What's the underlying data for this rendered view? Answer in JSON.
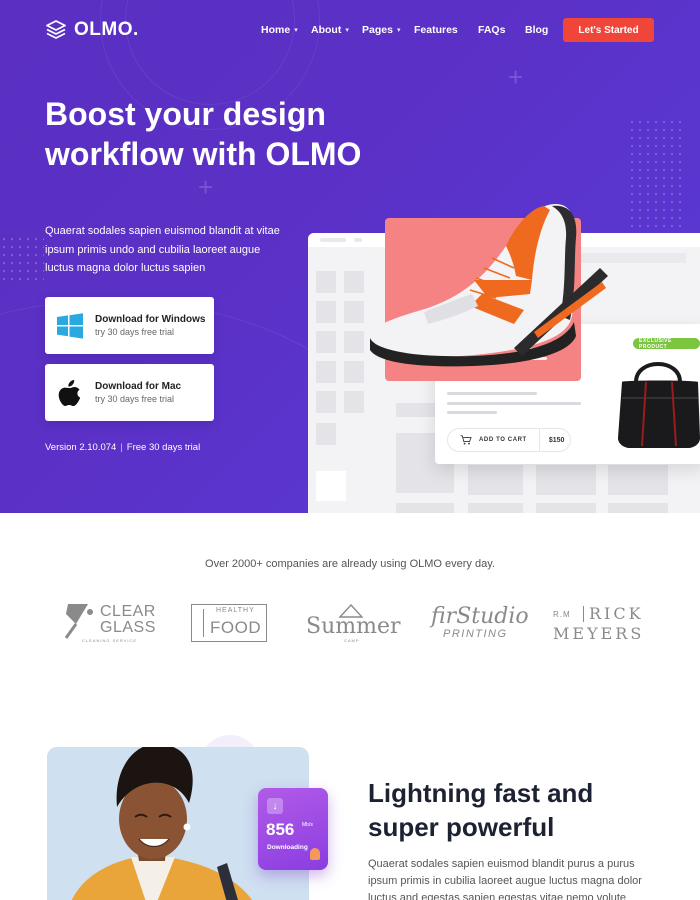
{
  "brand": {
    "name": "OLMO."
  },
  "nav": {
    "items": [
      {
        "label": "Home",
        "has_dropdown": true
      },
      {
        "label": "About",
        "has_dropdown": true
      },
      {
        "label": "Pages",
        "has_dropdown": true
      },
      {
        "label": "Features",
        "has_dropdown": false
      },
      {
        "label": "FAQs",
        "has_dropdown": false
      },
      {
        "label": "Blog",
        "has_dropdown": false
      }
    ],
    "cta_label": "Let's Started"
  },
  "hero": {
    "title": "Boost your design workflow with OLMO",
    "description": "Quaerat sodales sapien euismod blandit at vitae ipsum primis undo and cubilia laoreet augue luctus magna dolor luctus sapien",
    "windows_button": {
      "title": "Download for Windows",
      "subtitle": "try 30 days free trial",
      "icon": "windows-icon"
    },
    "mac_button": {
      "title": "Download for Mac",
      "subtitle": "try 30 days free trial",
      "icon": "apple-icon"
    },
    "version": "Version 2.10.074",
    "trial": "Free 30 days trial"
  },
  "mockup": {
    "add_to_cart": "ADD TO CART",
    "price": "$150",
    "badge": "EXCLUSIVE PRODUCT"
  },
  "companies": {
    "text": "Over 2000+ companies are already using OLMO every day.",
    "logos": [
      {
        "line1": "CLEAR",
        "line2": "GLASS",
        "line3": "CLEANING SERVICE"
      },
      {
        "line1": "HEALTHY",
        "line2": "FOOD"
      },
      {
        "line1": "Summer",
        "line2": "CAMP"
      },
      {
        "line1": "firStudio",
        "line2": "PRINTING"
      },
      {
        "line1": "R.M",
        "line2": "RICK",
        "line3": "MEYERS"
      }
    ]
  },
  "feature": {
    "title": "Lightning fast and super powerful",
    "description": "Quaerat sodales sapien euismod blandit purus a purus ipsum primis in cubilia laoreet augue luctus magna dolor luctus and egestas sapien egestas vitae nemo volute",
    "download_value": "856",
    "download_unit": "Mb/s",
    "download_label": "Downloading"
  },
  "colors": {
    "hero_bg": "#5b30c6",
    "cta": "#f0463a",
    "pink_card": "#f68383",
    "badge": "#7bc63e",
    "download_card": "#9a4ae4"
  }
}
